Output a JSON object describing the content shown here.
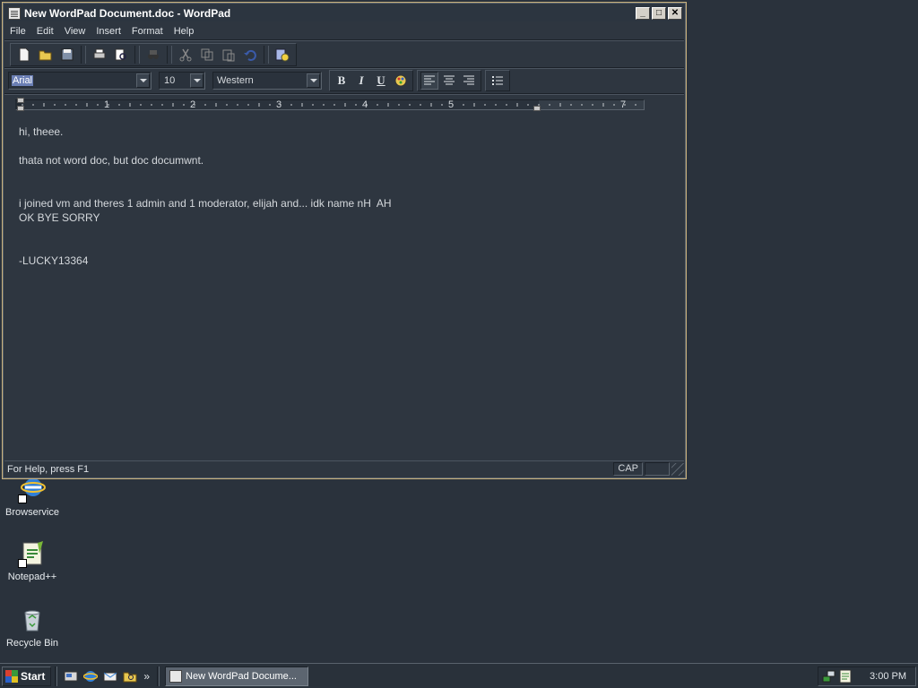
{
  "window": {
    "title": "New WordPad Document.doc - WordPad",
    "minimize": "_",
    "maximize": "□",
    "close": "✕"
  },
  "menu": [
    "File",
    "Edit",
    "View",
    "Insert",
    "Format",
    "Help"
  ],
  "format_bar": {
    "font": "Arial",
    "size": "10",
    "script": "Western",
    "bold": "B",
    "italic": "I",
    "underline": "U"
  },
  "ruler": {
    "numbers": [
      "1",
      "2",
      "3",
      "4",
      "5",
      "7"
    ]
  },
  "document": {
    "lines": [
      "hi, theee.",
      "",
      "thata not word doc, but doc documwnt.",
      "",
      "",
      "i joined vm and theres 1 admin and 1 moderator, elijah and... idk name nH  AH",
      "OK BYE SORRY",
      "",
      "",
      "-LUCKY13364"
    ]
  },
  "status": {
    "help": "For Help, press F1",
    "cap": "CAP"
  },
  "desktop": {
    "icons": [
      {
        "label": "Browservice",
        "icon": "ie-icon"
      },
      {
        "label": "Notepad++",
        "icon": "notepadpp-icon"
      },
      {
        "label": "Recycle Bin",
        "icon": "recycle-bin-icon"
      }
    ]
  },
  "taskbar": {
    "start": "Start",
    "more": "»",
    "task": "New WordPad Docume...",
    "clock": "3:00 PM"
  },
  "colors": {
    "desktop": "#2a323c",
    "window_border": "#c8b07a",
    "selection": "#6b7fb5"
  }
}
